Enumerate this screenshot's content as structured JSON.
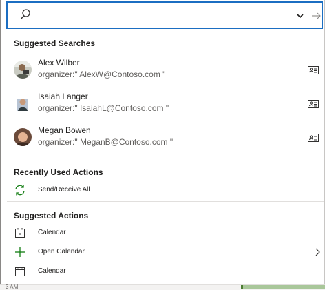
{
  "search": {
    "placeholder": ""
  },
  "sections": {
    "suggested_searches": "Suggested Searches",
    "recently_used_actions": "Recently Used Actions",
    "suggested_actions": "Suggested Actions"
  },
  "people": [
    {
      "name": "Alex Wilber",
      "query": "organizer:\" AlexW@Contoso.com \""
    },
    {
      "name": "Isaiah Langer",
      "query": "organizer:\" IsaiahL@Contoso.com \""
    },
    {
      "name": "Megan Bowen",
      "query": "organizer:\" MeganB@Contoso.com \""
    }
  ],
  "recent_actions": [
    {
      "label": "Send/Receive All",
      "icon": "sync-icon"
    }
  ],
  "suggested_actions": [
    {
      "label": "Calendar",
      "icon": "calendar-day-icon"
    },
    {
      "label": "Open Calendar",
      "icon": "plus-icon",
      "has_submenu": true
    },
    {
      "label": "Calendar",
      "icon": "calendar-icon"
    }
  ],
  "calendar_strip": {
    "time": "3 AM"
  },
  "colors": {
    "accent": "#1b6ec2",
    "sync": "#107c10",
    "event": "#a9c79a"
  }
}
